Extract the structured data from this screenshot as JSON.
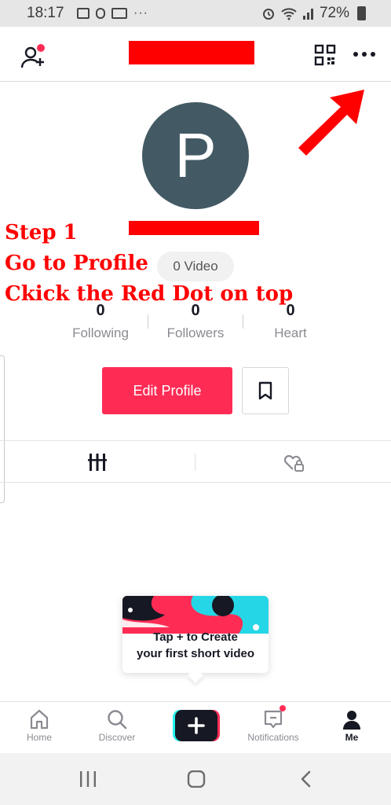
{
  "status_bar": {
    "time": "18:17",
    "dots": "···",
    "battery": "72%"
  },
  "header": {
    "add_friends_icon": "person-add-icon",
    "qr_icon": "qr-code-icon",
    "more_icon": "more-horizontal-icon",
    "notification_dot_color": "#fe2c55",
    "redaction_color": "#ff0000"
  },
  "profile": {
    "avatar_letter": "P",
    "avatar_color": "#435a65",
    "video_count": "0 Video"
  },
  "annotation": {
    "line1": "Step 1",
    "line2": "Go to Profile",
    "line3": "Ckick the Red Dot on top",
    "color": "#ff0000"
  },
  "stats": [
    {
      "value": "0",
      "label": "Following"
    },
    {
      "value": "0",
      "label": "Followers"
    },
    {
      "value": "0",
      "label": "Heart"
    }
  ],
  "actions": {
    "edit_profile": "Edit Profile",
    "edit_profile_color": "#fe2c55",
    "bookmark_icon": "bookmark-icon"
  },
  "tabs": {
    "videos_icon": "videos-grid-icon",
    "liked_icon": "liked-private-icon"
  },
  "tip": {
    "line1": "Tap + to Create",
    "line2": "your first short video"
  },
  "bottom_nav": {
    "home": "Home",
    "discover": "Discover",
    "notifications": "Notifications",
    "me": "Me"
  }
}
